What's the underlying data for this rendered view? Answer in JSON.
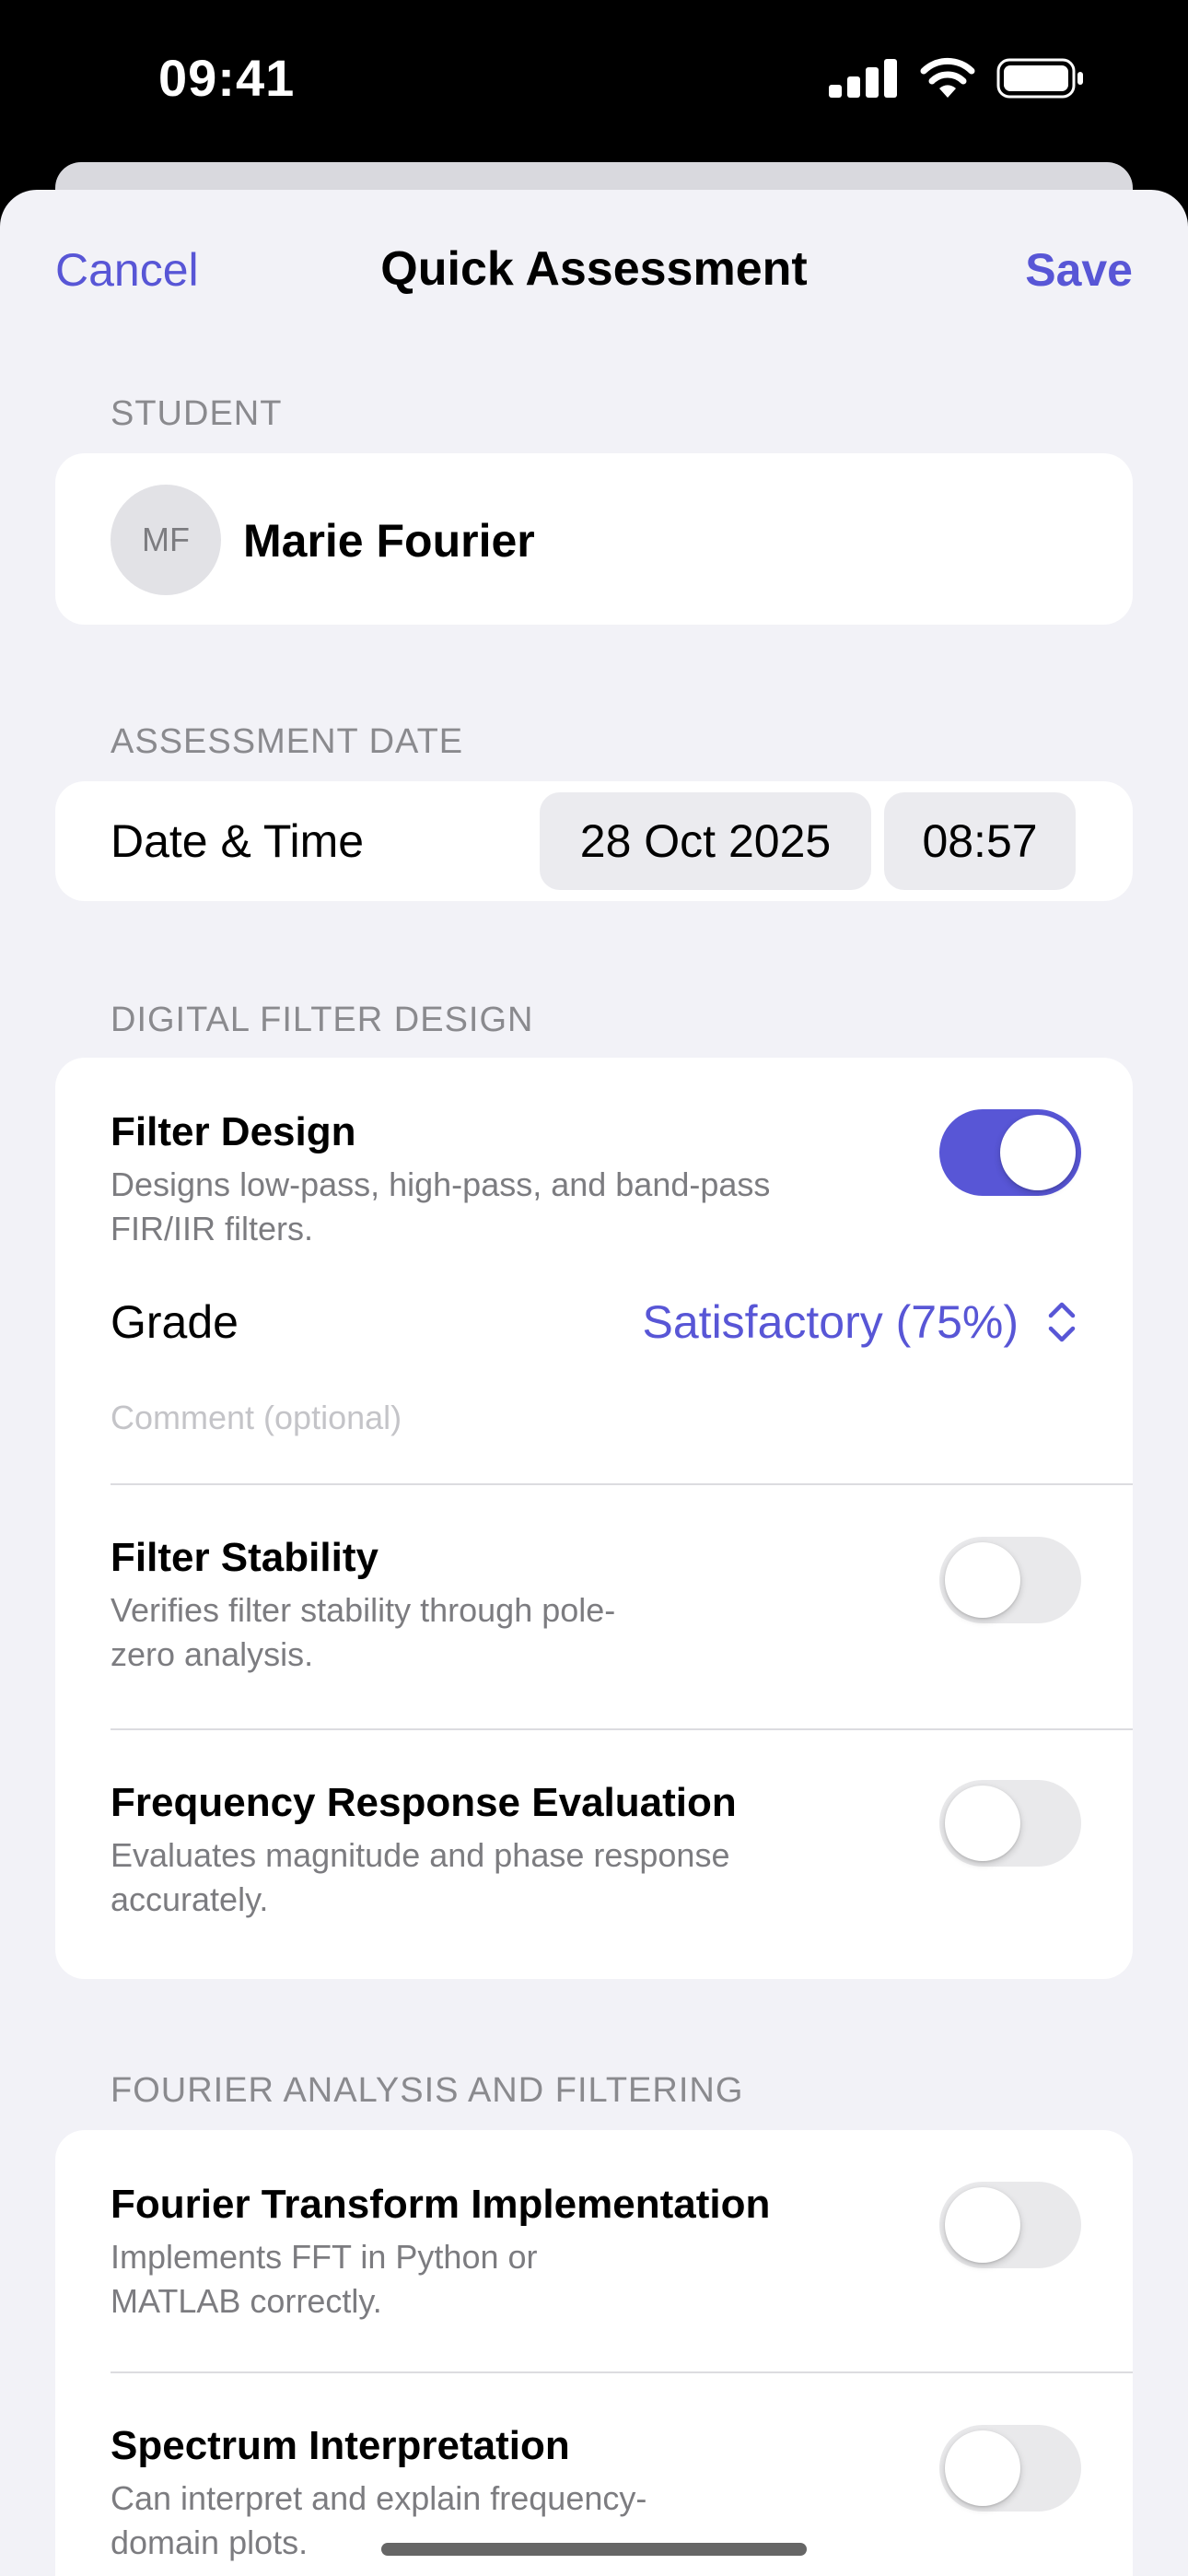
{
  "status_bar": {
    "time": "09:41"
  },
  "nav": {
    "cancel_label": "Cancel",
    "title": "Quick Assessment",
    "save_label": "Save"
  },
  "student": {
    "header": "STUDENT",
    "initials": "MF",
    "name": "Marie Fourier"
  },
  "assessment_date": {
    "header": "ASSESSMENT DATE",
    "label": "Date & Time",
    "date": "28 Oct 2025",
    "time": "08:57"
  },
  "digital_filter": {
    "header": "DIGITAL FILTER DESIGN",
    "items": [
      {
        "title": "Filter Design",
        "desc_line1": "Designs low-pass, high-pass, and band-pass",
        "desc_line2": "FIR/IIR filters.",
        "enabled": true,
        "grade_label": "Grade",
        "grade_value": "Satisfactory (75%)",
        "comment_placeholder": "Comment (optional)"
      },
      {
        "title": "Filter Stability",
        "desc_line1": "Verifies filter stability through pole-",
        "desc_line2": "zero analysis.",
        "enabled": false
      },
      {
        "title": "Frequency Response Evaluation",
        "desc_line1": "Evaluates magnitude and phase response",
        "desc_line2": "accurately.",
        "enabled": false
      }
    ]
  },
  "fourier": {
    "header": "FOURIER ANALYSIS AND FILTERING",
    "items": [
      {
        "title": "Fourier Transform Implementation",
        "desc_line1": "Implements FFT in Python or",
        "desc_line2": "MATLAB correctly.",
        "enabled": false
      },
      {
        "title": "Spectrum Interpretation",
        "desc_line1": "Can interpret and explain frequency-",
        "desc_line2": "domain plots.",
        "enabled": false
      }
    ]
  },
  "colors": {
    "accent": "#5856d6",
    "background": "#f2f2f7",
    "card": "#ffffff",
    "secondary_text": "#7c7c80"
  }
}
